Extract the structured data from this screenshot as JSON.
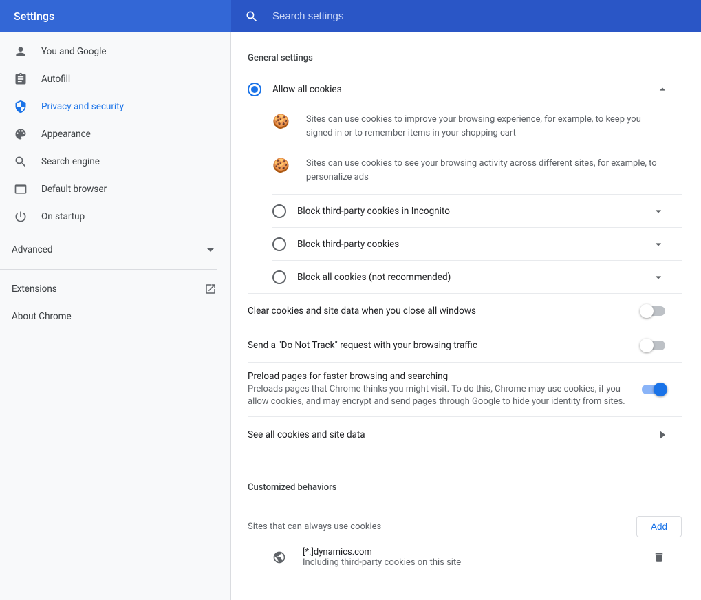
{
  "header": {
    "title": "Settings",
    "search_placeholder": "Search settings"
  },
  "sidebar": {
    "items": [
      {
        "label": "You and Google"
      },
      {
        "label": "Autofill"
      },
      {
        "label": "Privacy and security"
      },
      {
        "label": "Appearance"
      },
      {
        "label": "Search engine"
      },
      {
        "label": "Default browser"
      },
      {
        "label": "On startup"
      }
    ],
    "advanced_label": "Advanced",
    "extensions_label": "Extensions",
    "about_label": "About Chrome"
  },
  "main": {
    "section_title": "General settings",
    "options": {
      "allow_all": "Allow all cookies",
      "block_incognito": "Block third-party cookies in Incognito",
      "block_third": "Block third-party cookies",
      "block_all": "Block all cookies (not recommended)",
      "detail1": "Sites can use cookies to improve your browsing experience, for example, to keep you signed in or to remember items in your shopping cart",
      "detail2": "Sites can use cookies to see your browsing activity across different sites, for example, to personalize ads"
    },
    "toggles": {
      "clear_on_exit": "Clear cookies and site data when you close all windows",
      "dnt": "Send a \"Do Not Track\" request with your browsing traffic",
      "preload_title": "Preload pages for faster browsing and searching",
      "preload_sub": "Preloads pages that Chrome thinks you might visit. To do this, Chrome may use cookies, if you allow cookies, and may encrypt and send pages through Google to hide your identity from sites."
    },
    "see_all": "See all cookies and site data",
    "custom_title": "Customized behaviors",
    "sites_label": "Sites that can always use cookies",
    "add_label": "Add",
    "site_entry": {
      "pattern": "[*.]dynamics.com",
      "sub": "Including third-party cookies on this site"
    }
  }
}
